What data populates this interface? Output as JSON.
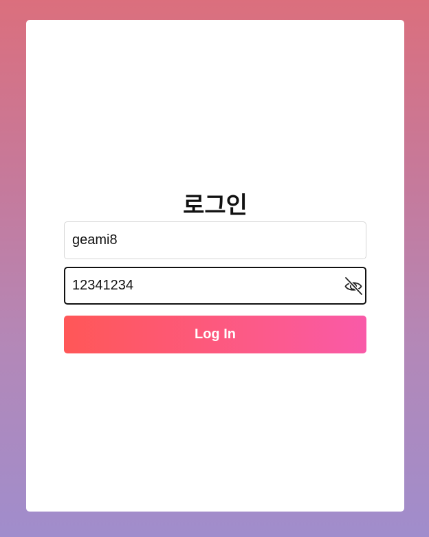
{
  "login": {
    "title": "로그인",
    "username": {
      "value": "geami8"
    },
    "password": {
      "value": "12341234",
      "toggle_icon": "eye-slash-icon"
    },
    "submit_label": "Log In"
  },
  "colors": {
    "background_top": "#db6f7d",
    "background_bottom": "#a08dcc",
    "button_start": "#ff5757",
    "button_end": "#f95aa8",
    "card": "#ffffff"
  }
}
